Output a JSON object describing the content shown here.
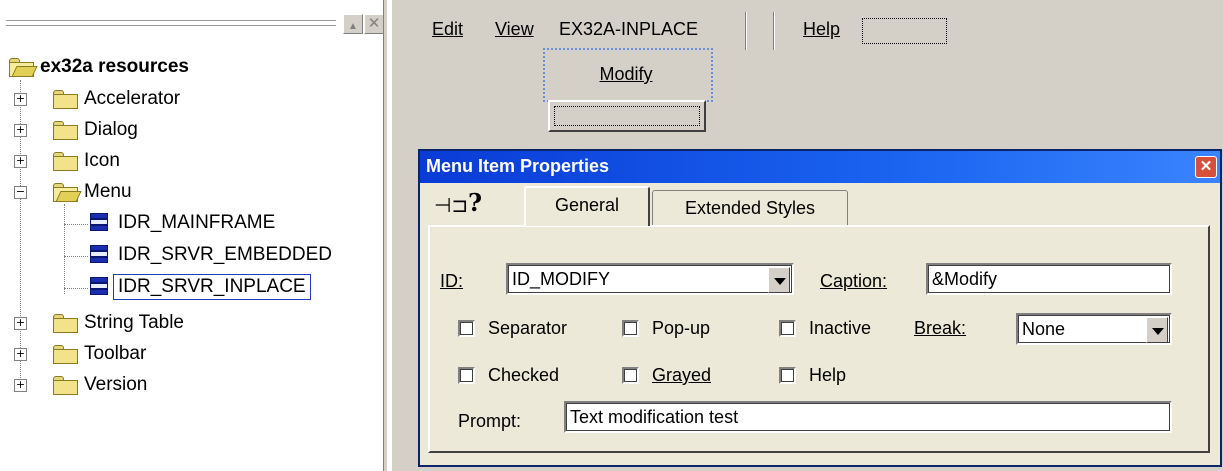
{
  "tree": {
    "root": "ex32a resources",
    "folders": {
      "accelerator": "Accelerator",
      "dialog": "Dialog",
      "icon": "Icon",
      "menu": "Menu",
      "string_table": "String Table",
      "toolbar": "Toolbar",
      "version": "Version"
    },
    "menu_items": [
      "IDR_MAINFRAME",
      "IDR_SRVR_EMBEDDED",
      "IDR_SRVR_INPLACE"
    ],
    "selected": "IDR_SRVR_INPLACE",
    "pane_buttons": {
      "maximize": "▲",
      "close": "✕"
    }
  },
  "menubar": {
    "edit": "Edit",
    "view": "View",
    "ex32a_inplace": "EX32A-INPLACE",
    "help": "Help"
  },
  "dropdown": {
    "item": "Modify"
  },
  "dialog": {
    "title": "Menu Item Properties",
    "close_glyph": "✕",
    "pin_glyph": "⊣⊐",
    "help_glyph": "?",
    "tabs": {
      "general": "General",
      "extended": "Extended Styles"
    },
    "fields": {
      "id_label": "ID:",
      "id_value": "ID_MODIFY",
      "caption_label": "Caption:",
      "caption_value": "&Modify",
      "break_label": "Break:",
      "break_value": "None",
      "prompt_label": "Prompt:",
      "prompt_value": "Text modification test"
    },
    "checkboxes": {
      "separator": {
        "label": "Separator",
        "checked": false
      },
      "popup": {
        "label": "Pop-up",
        "checked": false
      },
      "inactive": {
        "label": "Inactive",
        "checked": false
      },
      "checked": {
        "label": "Checked",
        "checked": false
      },
      "grayed": {
        "label": "Grayed",
        "checked": false
      },
      "help": {
        "label": "Help",
        "checked": false
      }
    }
  },
  "colors": {
    "title_gradient_start": "#0a3bd6",
    "title_gradient_end": "#3a84ff",
    "face": "#d4d0c8",
    "dialog_face": "#ece9d8",
    "selection_border": "#1a3fb8",
    "close_red": "#d6503a"
  }
}
